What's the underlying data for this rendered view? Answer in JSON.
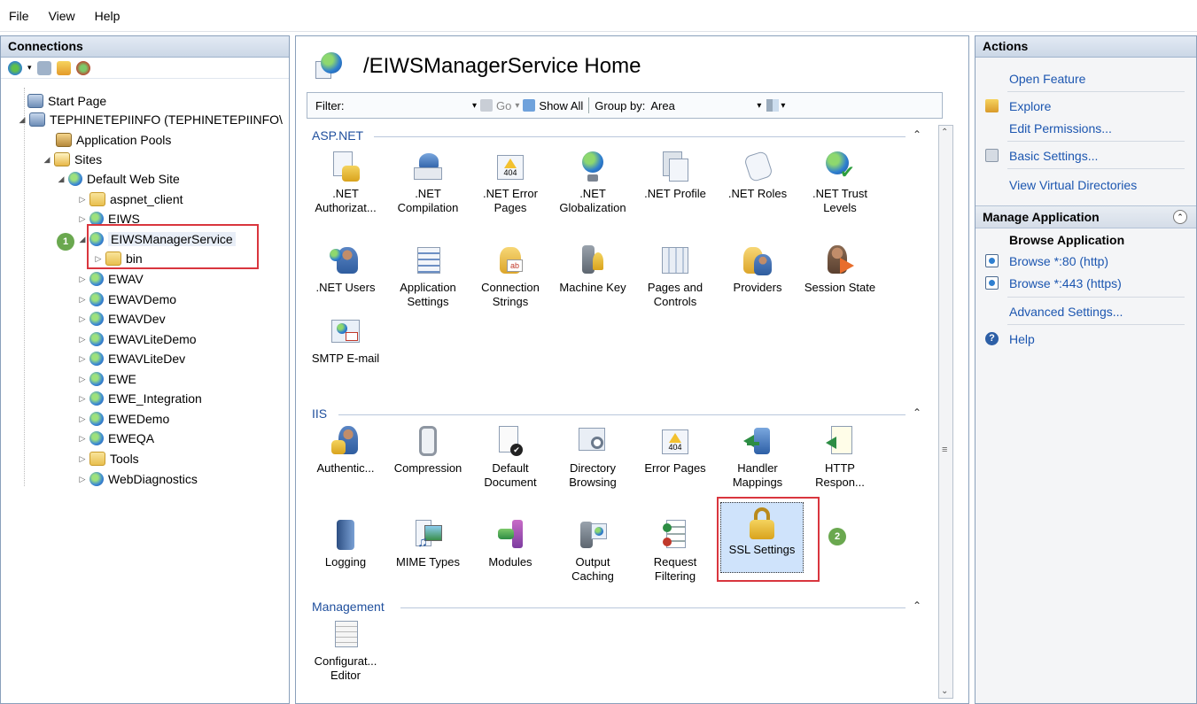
{
  "menu": [
    "File",
    "View",
    "Help"
  ],
  "connections": {
    "title": "Connections",
    "tree": {
      "start_page": "Start Page",
      "server": "TEPHINETEPIINFO (TEPHINETEPIINFO\\",
      "app_pools": "Application Pools",
      "sites": "Sites",
      "default_site": "Default Web Site",
      "children": [
        "aspnet_client",
        "EIWS",
        "EIWSManagerService",
        "bin",
        "EWAV",
        "EWAVDemo",
        "EWAVDev",
        "EWAVLiteDemo",
        "EWAVLiteDev",
        "EWE",
        "EWE_Integration",
        "EWEDemo",
        "EWEQA",
        "Tools",
        "WebDiagnostics"
      ]
    },
    "badge": "1"
  },
  "center": {
    "title": "/EIWSManagerService Home",
    "filter_label": "Filter:",
    "go_label": "Go",
    "show_all_label": "Show All",
    "group_by_label": "Group by:",
    "group_by_value": "Area",
    "groups": {
      "aspnet": "ASP.NET",
      "iis": "IIS",
      "management": "Management"
    },
    "aspnet_features": [
      {
        "line1": ".NET",
        "line2": "Authorizat..."
      },
      {
        "line1": ".NET",
        "line2": "Compilation"
      },
      {
        "line1": ".NET Error",
        "line2": "Pages"
      },
      {
        "line1": ".NET",
        "line2": "Globalization"
      },
      {
        "line1": ".NET Profile",
        "line2": ""
      },
      {
        "line1": ".NET Roles",
        "line2": ""
      },
      {
        "line1": ".NET Trust",
        "line2": "Levels"
      },
      {
        "line1": ".NET Users",
        "line2": ""
      },
      {
        "line1": "Application",
        "line2": "Settings"
      },
      {
        "line1": "Connection",
        "line2": "Strings"
      },
      {
        "line1": "Machine Key",
        "line2": ""
      },
      {
        "line1": "Pages and",
        "line2": "Controls"
      },
      {
        "line1": "Providers",
        "line2": ""
      },
      {
        "line1": "Session State",
        "line2": ""
      },
      {
        "line1": "SMTP E-mail",
        "line2": ""
      }
    ],
    "iis_features": [
      {
        "line1": "Authentic...",
        "line2": ""
      },
      {
        "line1": "Compression",
        "line2": ""
      },
      {
        "line1": "Default",
        "line2": "Document"
      },
      {
        "line1": "Directory",
        "line2": "Browsing"
      },
      {
        "line1": "Error Pages",
        "line2": ""
      },
      {
        "line1": "Handler",
        "line2": "Mappings"
      },
      {
        "line1": "HTTP",
        "line2": "Respon..."
      },
      {
        "line1": "Logging",
        "line2": ""
      },
      {
        "line1": "MIME Types",
        "line2": ""
      },
      {
        "line1": "Modules",
        "line2": ""
      },
      {
        "line1": "Output",
        "line2": "Caching"
      },
      {
        "line1": "Request",
        "line2": "Filtering"
      },
      {
        "line1": "SSL Settings",
        "line2": ""
      }
    ],
    "management_features": [
      {
        "line1": "Configurat...",
        "line2": "Editor"
      }
    ],
    "badge": "2",
    "error_glyph": "404"
  },
  "actions": {
    "title": "Actions",
    "open_feature": "Open Feature",
    "explore": "Explore",
    "edit_permissions": "Edit Permissions...",
    "basic_settings": "Basic Settings...",
    "view_virtual_dirs": "View Virtual Directories",
    "manage_app_header": "Manage Application",
    "browse_app": "Browse Application",
    "browse_80": "Browse *:80 (http)",
    "browse_443": "Browse *:443 (https)",
    "advanced_settings": "Advanced Settings...",
    "help": "Help"
  }
}
